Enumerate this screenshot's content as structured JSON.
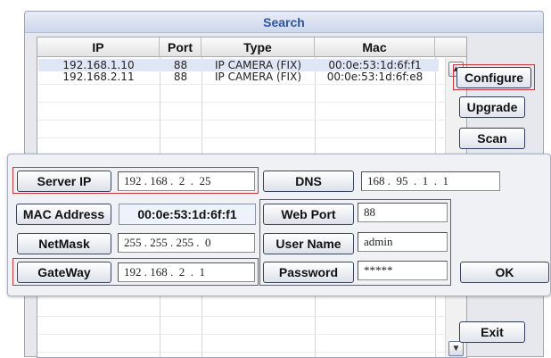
{
  "window": {
    "title": "Search"
  },
  "table": {
    "columns": [
      "IP",
      "Port",
      "Type",
      "Mac"
    ],
    "rows": [
      {
        "ip": "192.168.1.10",
        "port": "88",
        "type": "IP CAMERA (FIX)",
        "mac": "00:0e:53:1d:6f:f1"
      },
      {
        "ip": "192.168.2.11",
        "port": "88",
        "type": "IP CAMERA (FIX)",
        "mac": "00:0e:53:1d:6f:e8"
      }
    ]
  },
  "scroll": {
    "up_icon": "triangle-up-icon",
    "down_icon": "triangle-down-icon"
  },
  "buttons": {
    "configure": "Configure",
    "upgrade": "Upgrade",
    "scan": "Scan",
    "ok": "OK",
    "exit": "Exit"
  },
  "config": {
    "server_ip": {
      "label": "Server IP",
      "value": "192 . 168 .  2  .  25"
    },
    "mac_address": {
      "label": "MAC Address",
      "value": "00:0e:53:1d:6f:f1"
    },
    "netmask": {
      "label": "NetMask",
      "value": "255 . 255 . 255 .  0"
    },
    "gateway": {
      "label": "GateWay",
      "value": "192 . 168 .  2  .  1"
    },
    "dns": {
      "label": "DNS",
      "value": "168 .  95  .  1  .  1"
    },
    "web_port": {
      "label": "Web Port",
      "value": "88"
    },
    "user_name": {
      "label": "User Name",
      "value": "admin"
    },
    "password": {
      "label": "Password",
      "value": "*****"
    }
  },
  "colors": {
    "highlight": "#c9353b",
    "title_text": "#2b55a6"
  }
}
